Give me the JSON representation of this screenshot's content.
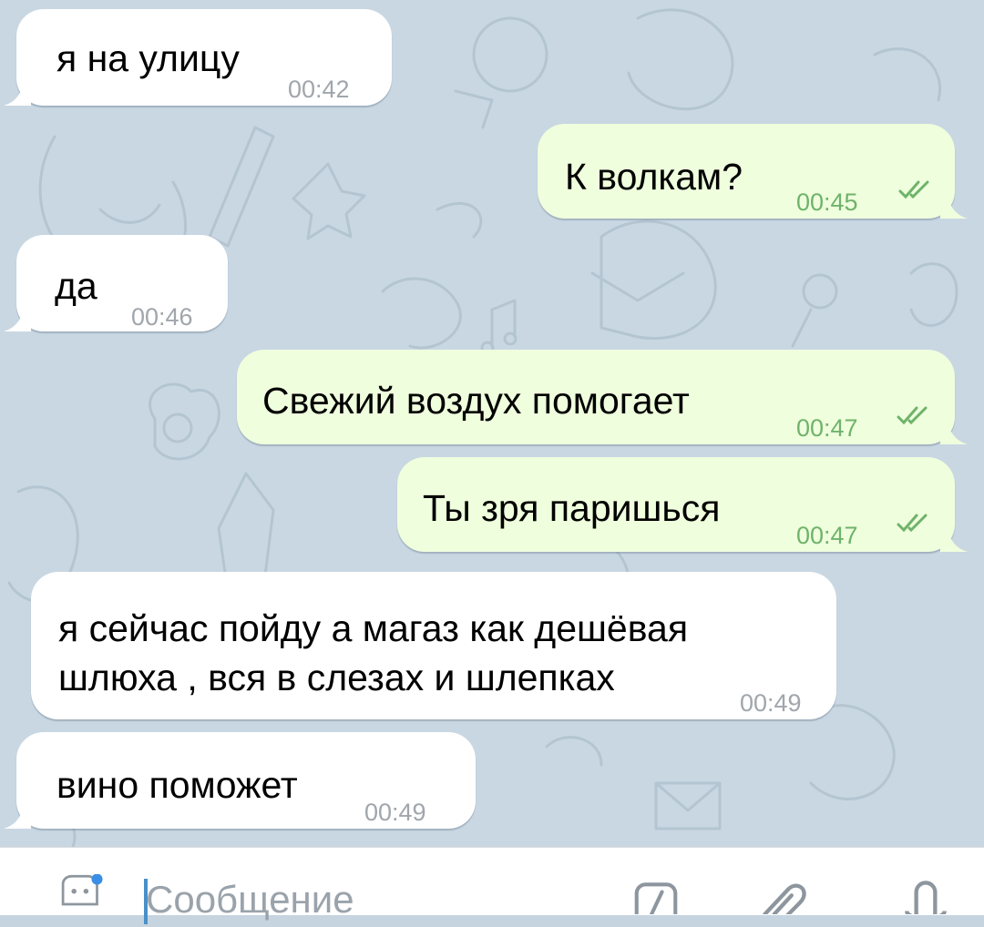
{
  "messages": [
    {
      "direction": "in",
      "text": "я на улицу",
      "time": "00:42"
    },
    {
      "direction": "out",
      "text": "К волкам?",
      "time": "00:45",
      "status": "read"
    },
    {
      "direction": "in",
      "text": "да",
      "time": "00:46"
    },
    {
      "direction": "out",
      "text": "Свежий воздух помогает",
      "time": "00:47",
      "status": "read"
    },
    {
      "direction": "out",
      "text": "Ты зря паришься",
      "time": "00:47",
      "status": "read"
    },
    {
      "direction": "in",
      "lines": [
        "я сейчас пойду а магаз как дешёвая",
        "шлюха , вся в слезах и шлепках"
      ],
      "time": "00:49"
    },
    {
      "direction": "in",
      "text": "вино поможет",
      "time": "00:49"
    }
  ],
  "composer": {
    "placeholder": "Сообщение",
    "icons": [
      "emoji-sticker-icon",
      "bot-commands-icon",
      "paperclip-icon",
      "microphone-icon"
    ]
  },
  "colors": {
    "background": "#c9d7e2",
    "incoming_bubble": "#ffffff",
    "outgoing_bubble": "#effedd",
    "outgoing_time": "#6fb36b",
    "incoming_time": "#a0a6ac"
  }
}
